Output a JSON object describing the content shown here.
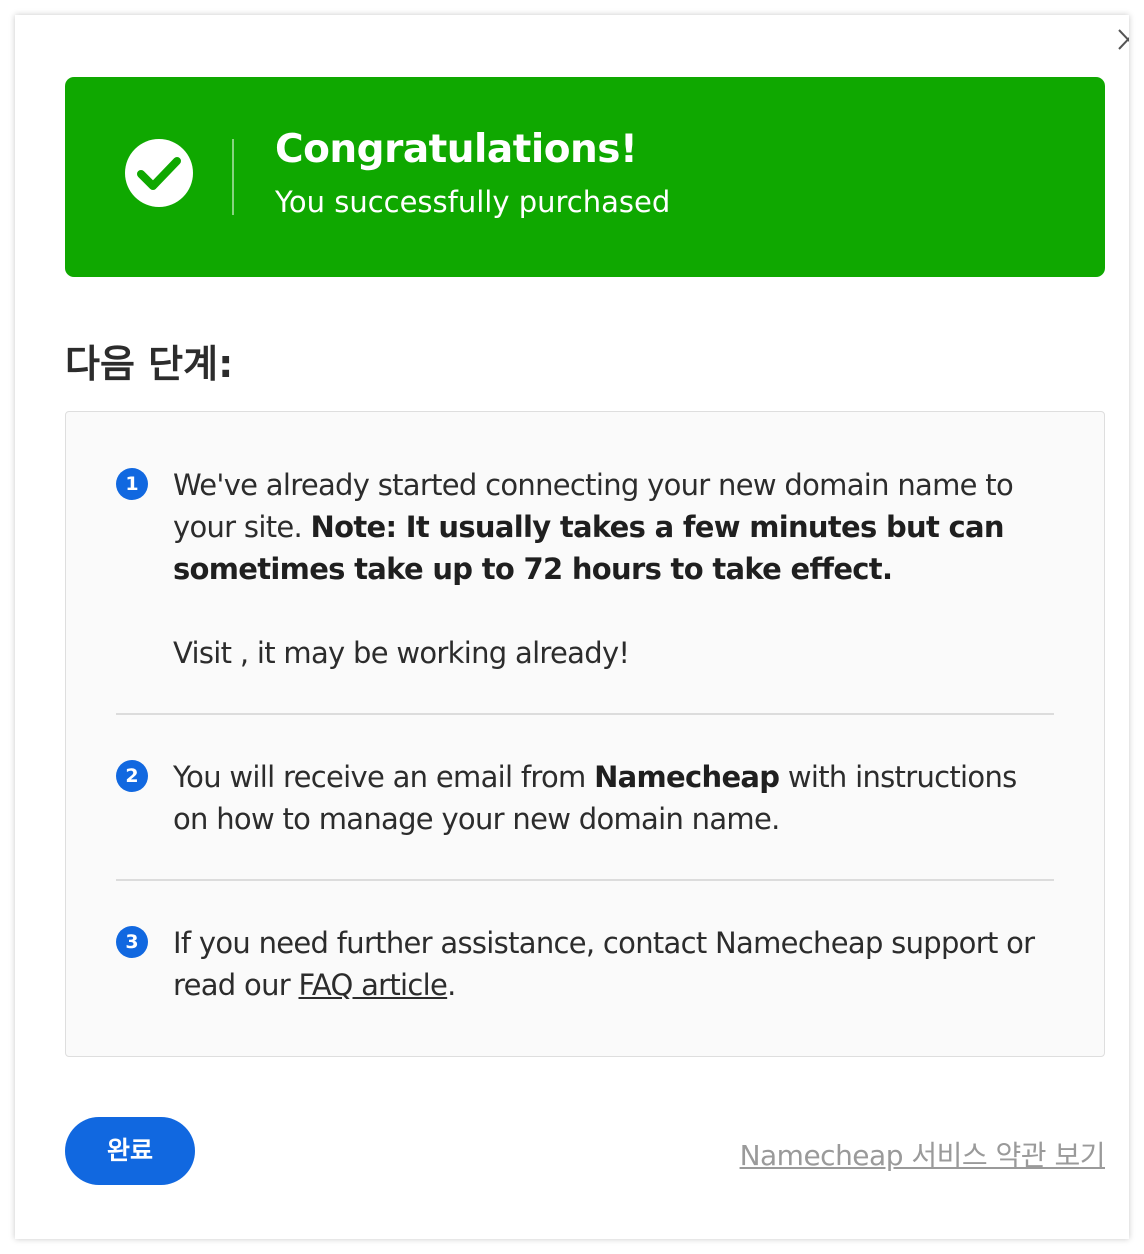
{
  "banner": {
    "title": "Congratulations!",
    "subtitle": "You successfully purchased",
    "color": "#0fa800"
  },
  "next_steps": {
    "heading": "다음 단계:",
    "steps": [
      {
        "number": "1",
        "text_start": "We've already started connecting your new domain name to your site. ",
        "text_bold": "Note: It usually takes a few minutes but can sometimes take up to 72 hours to take effect.",
        "visit_text": "Visit , it may be working already!"
      },
      {
        "number": "2",
        "text_start": "You will receive an email from ",
        "text_bold": "Namecheap",
        "text_end": " with instructions on how to manage your new domain name."
      },
      {
        "number": "3",
        "text_start": "If you need further assistance, contact Namecheap support or read our ",
        "link": "FAQ article",
        "text_end": "."
      }
    ]
  },
  "footer": {
    "done_label": "완료",
    "terms_link": "Namecheap 서비스 약관 보기"
  },
  "icons": {
    "close": "close-icon",
    "check": "checkmark-circle-icon"
  },
  "colors": {
    "accent": "#1168e0",
    "success": "#0fa800"
  }
}
